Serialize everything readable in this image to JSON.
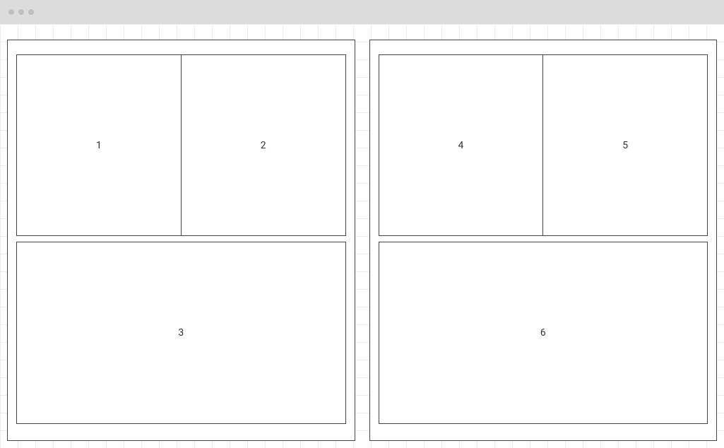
{
  "layout": {
    "containers": [
      {
        "top_cells": [
          {
            "label": "1"
          },
          {
            "label": "2"
          }
        ],
        "bottom_cell": {
          "label": "3"
        }
      },
      {
        "top_cells": [
          {
            "label": "4"
          },
          {
            "label": "5"
          }
        ],
        "bottom_cell": {
          "label": "6"
        }
      }
    ]
  }
}
